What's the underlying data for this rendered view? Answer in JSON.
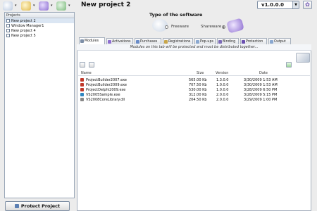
{
  "toolbar": {
    "buttons": [
      "new-project",
      "open-project",
      "save-project",
      "settings"
    ]
  },
  "project_title": "New project 2",
  "version": {
    "value": "v1.0.0.0"
  },
  "sidebar": {
    "header": "Projects",
    "items": [
      {
        "label": "New project 2",
        "selected": true
      },
      {
        "label": "Window Manager1"
      },
      {
        "label": "New project 4"
      },
      {
        "label": "New project 5"
      }
    ],
    "protect_button": "Protect Project"
  },
  "software_type": {
    "label": "Type of the software",
    "freeware": "Freeware",
    "shareware": "Shareware",
    "selected": "Shareware"
  },
  "tabs": [
    {
      "label": "Modules",
      "active": true
    },
    {
      "label": "Activations"
    },
    {
      "label": "Purchases"
    },
    {
      "label": "Registrations"
    },
    {
      "label": "Pop-ups"
    },
    {
      "label": "Binding"
    },
    {
      "label": "Protection"
    },
    {
      "label": "Output"
    }
  ],
  "modules": {
    "notice": "Modules on this tab will be protected and must be distributed together...",
    "columns": {
      "name": "Name",
      "size": "Size",
      "version": "Version",
      "date": "Date"
    },
    "rows": [
      {
        "name": "ProjectBuilder2007.exe",
        "size": "565.00 Kb",
        "version": "1.3.0.0",
        "date": "3/30/2009 1:53 AM",
        "icon": "#c0392b"
      },
      {
        "name": "ProjectBuilder2009.exe",
        "size": "707.50 Kb",
        "version": "1.0.0.0",
        "date": "3/30/2009 1:53 AM",
        "icon": "#c0392b"
      },
      {
        "name": "ProjectDelphi2009.exe",
        "size": "530.00 Kb",
        "version": "1.0.0.0",
        "date": "3/28/2009 6:50 PM",
        "icon": "#c0392b"
      },
      {
        "name": "VS2005Sample.exe",
        "size": "312.00 Kb",
        "version": "2.0.0.0",
        "date": "3/28/2009 5:15 PM",
        "icon": "#2e86c1"
      },
      {
        "name": "VS2008CoreLibrary.dll",
        "size": "204.50 Kb",
        "version": "2.0.0.0",
        "date": "3/29/2009 1:00 PM",
        "icon": "#888888"
      }
    ]
  },
  "colors": {
    "accent": "#6a4fb0",
    "selection": "#dbe6f3"
  }
}
